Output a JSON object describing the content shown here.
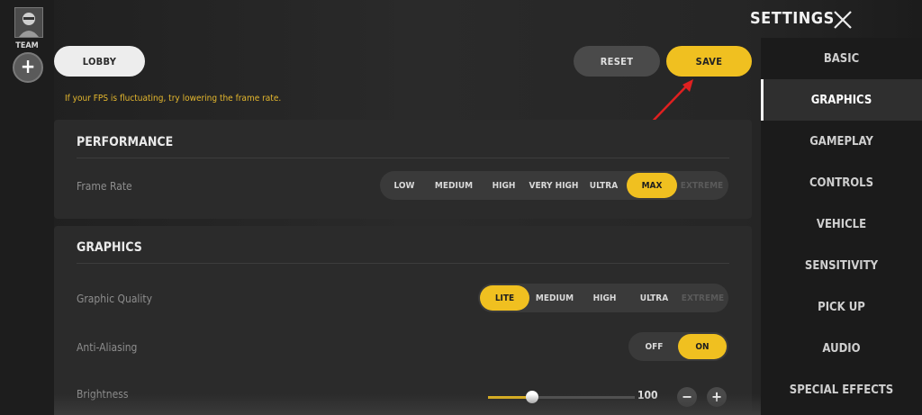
{
  "sidebar_left": {
    "team_label": "TEAM",
    "add_label": "+"
  },
  "top_buttons": {
    "lobby": "LOBBY",
    "reset": "RESET",
    "save": "SAVE"
  },
  "hint_text": "If your FPS is fluctuating, try lowering the frame rate.",
  "performance": {
    "title": "PERFORMANCE",
    "frame_rate": {
      "label": "Frame Rate",
      "options": [
        "LOW",
        "MEDIUM",
        "HIGH",
        "VERY HIGH",
        "ULTRA",
        "MAX",
        "EXTREME"
      ],
      "selected": "MAX",
      "disabled": [
        "EXTREME"
      ]
    }
  },
  "graphics": {
    "title": "GRAPHICS",
    "graphic_quality": {
      "label": "Graphic Quality",
      "options": [
        "LITE",
        "MEDIUM",
        "HIGH",
        "ULTRA",
        "EXTREME"
      ],
      "selected": "LITE",
      "disabled": [
        "EXTREME"
      ]
    },
    "anti_aliasing": {
      "label": "Anti-Aliasing",
      "options": [
        "OFF",
        "ON"
      ],
      "selected": "ON"
    },
    "brightness": {
      "label": "Brightness",
      "value": "100",
      "fill_fraction": 0.3,
      "minus": "−",
      "plus": "+"
    }
  },
  "settings_title": "SETTINGS",
  "nav": {
    "items": [
      "BASIC",
      "GRAPHICS",
      "GAMEPLAY",
      "CONTROLS",
      "VEHICLE",
      "SENSITIVITY",
      "PICK UP",
      "AUDIO",
      "SPECIAL EFFECTS"
    ],
    "active": "GRAPHICS"
  },
  "colors": {
    "accent": "#f0c020",
    "annotation_arrow": "#e02020"
  },
  "icons": {
    "close": "close-icon",
    "avatar": "avatar-icon",
    "add": "plus-icon"
  }
}
